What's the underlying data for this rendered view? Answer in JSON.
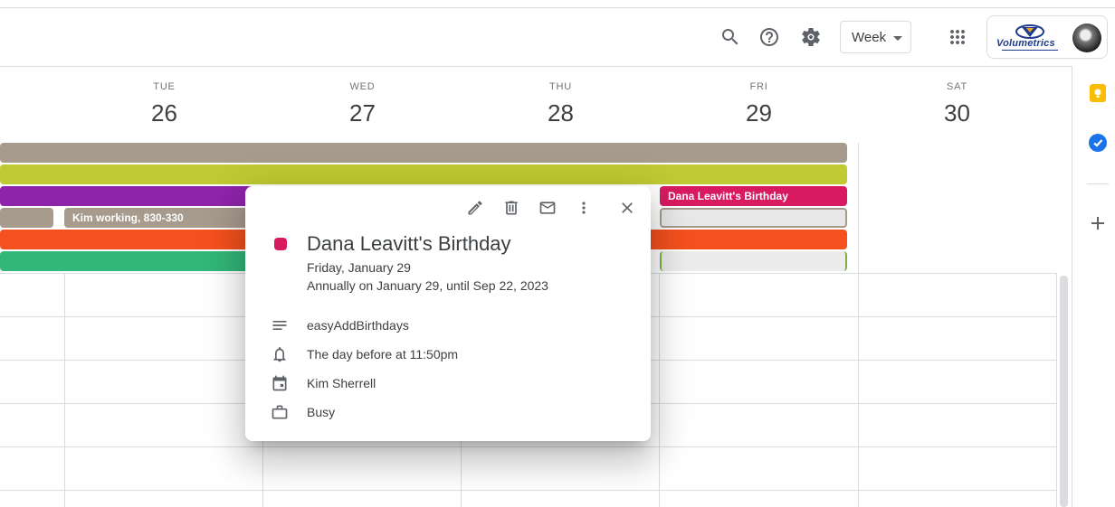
{
  "toolbar": {
    "view_label": "Week",
    "account_logo_text": "Volumetrics",
    "icons": [
      "search-icon",
      "help-icon",
      "settings-icon",
      "apps-grid-icon"
    ]
  },
  "days": [
    {
      "name": "TUE",
      "num": "26"
    },
    {
      "name": "WED",
      "num": "27"
    },
    {
      "name": "THU",
      "num": "28"
    },
    {
      "name": "FRI",
      "num": "29"
    },
    {
      "name": "SAT",
      "num": "30"
    }
  ],
  "events": {
    "kim_working": "Kim working, 830-330",
    "birthday_bar": "Dana Leavitt's Birthday"
  },
  "popup": {
    "title": "Dana Leavitt's Birthday",
    "date": "Friday, January 29",
    "recurrence": "Annually on January 29, until Sep 22, 2023",
    "description": "easyAddBirthdays",
    "reminder": "The day before at 11:50pm",
    "calendar": "Kim Sherrell",
    "availability": "Busy",
    "color": "#d81b60"
  },
  "colors": {
    "taupe": "#a79b8e",
    "citron": "#c0ca33",
    "grape": "#8e24aa",
    "tangerine": "#f4511e",
    "basil": "#33b679",
    "cherry": "#d81b60"
  }
}
